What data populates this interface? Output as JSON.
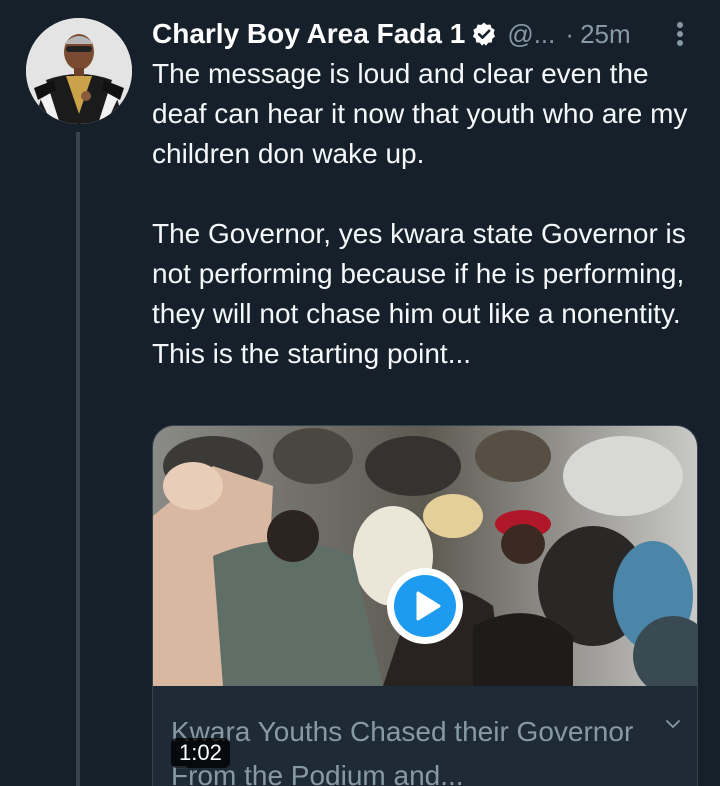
{
  "tweet": {
    "display_name": "Charly Boy Area Fada 1",
    "handle": "@...",
    "separator": "·",
    "time": "25m",
    "paragraphs": [
      "The message is loud and clear even the deaf can hear it now that youth who are my children don wake up.",
      "The Governor, yes kwara state Governor is not performing because if he is performing, they will not chase him out like a nonentity. This is the starting point..."
    ]
  },
  "card": {
    "title": "Kwara Youths Chased their Governor From the Podium and...",
    "duration": "1:02"
  },
  "icons": {
    "verified": "verified-badge-icon",
    "more": "more-vertical-icon",
    "play": "play-icon",
    "chevron": "chevron-down-icon"
  },
  "colors": {
    "background": "#15202b",
    "accent": "#1d9bf0",
    "secondary_text": "#8899a6"
  }
}
